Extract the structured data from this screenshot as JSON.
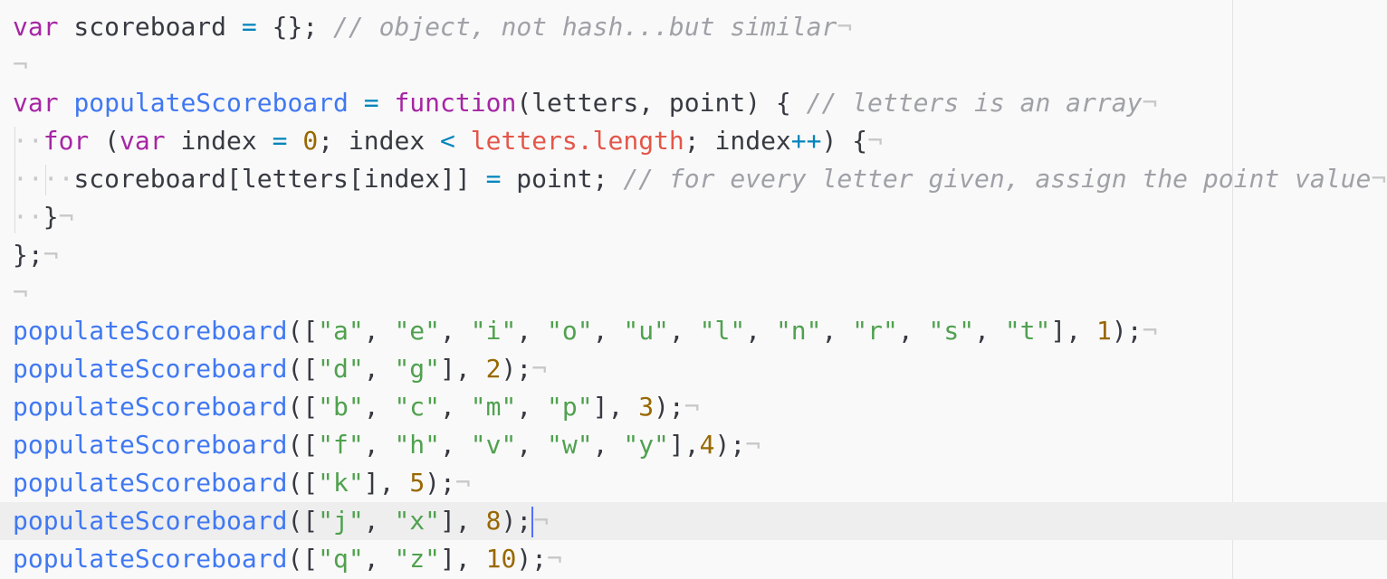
{
  "editor": {
    "eol_glyph": "¬",
    "indent_glyph": "·",
    "lines": {
      "l1": {
        "t1": "var",
        "t2": " scoreboard ",
        "t3": "=",
        "t4": " {};",
        "t5": " // object, not hash...but similar"
      },
      "l3": {
        "t1": "var",
        "t2": " ",
        "t3": "populateScoreboard",
        "t4": " ",
        "t5": "=",
        "t6": " ",
        "t7": "function",
        "t8": "(letters, point) { ",
        "t9": "// letters is an array"
      },
      "l4": {
        "t1": "for",
        "t2": " (",
        "t3": "var",
        "t4": " index ",
        "t5": "=",
        "t6": " ",
        "t7": "0",
        "t8": "; index ",
        "t9": "<",
        "t10": " letters",
        "t11": ".length",
        "t12": "; index",
        "t13": "++",
        "t14": ") {"
      },
      "l5": {
        "t1": "scoreboard[letters[index]] ",
        "t2": "=",
        "t3": " point; ",
        "t4": "// for every letter given, assign the point value"
      },
      "l6": {
        "t1": "}"
      },
      "l7": {
        "t1": "};"
      }
    },
    "calls": [
      {
        "fn": "populateScoreboard",
        "open": "([",
        "strs": [
          "\"a\"",
          "\"e\"",
          "\"i\"",
          "\"o\"",
          "\"u\"",
          "\"l\"",
          "\"n\"",
          "\"r\"",
          "\"s\"",
          "\"t\""
        ],
        "sep_after_array": "], ",
        "num": "1",
        "close": ");"
      },
      {
        "fn": "populateScoreboard",
        "open": "([",
        "strs": [
          "\"d\"",
          "\"g\""
        ],
        "sep_after_array": "], ",
        "num": "2",
        "close": ");"
      },
      {
        "fn": "populateScoreboard",
        "open": "([",
        "strs": [
          "\"b\"",
          "\"c\"",
          "\"m\"",
          "\"p\""
        ],
        "sep_after_array": "], ",
        "num": "3",
        "close": ");"
      },
      {
        "fn": "populateScoreboard",
        "open": "([",
        "strs": [
          "\"f\"",
          "\"h\"",
          "\"v\"",
          "\"w\"",
          "\"y\""
        ],
        "sep_after_array": "],",
        "num": "4",
        "close": ");"
      },
      {
        "fn": "populateScoreboard",
        "open": "([",
        "strs": [
          "\"k\""
        ],
        "sep_after_array": "], ",
        "num": "5",
        "close": ");"
      },
      {
        "fn": "populateScoreboard",
        "open": "([",
        "strs": [
          "\"j\"",
          "\"x\""
        ],
        "sep_after_array": "], ",
        "num": "8",
        "close": ");"
      },
      {
        "fn": "populateScoreboard",
        "open": "([",
        "strs": [
          "\"q\"",
          "\"z\""
        ],
        "sep_after_array": "], ",
        "num": "10",
        "close": ");"
      }
    ]
  }
}
